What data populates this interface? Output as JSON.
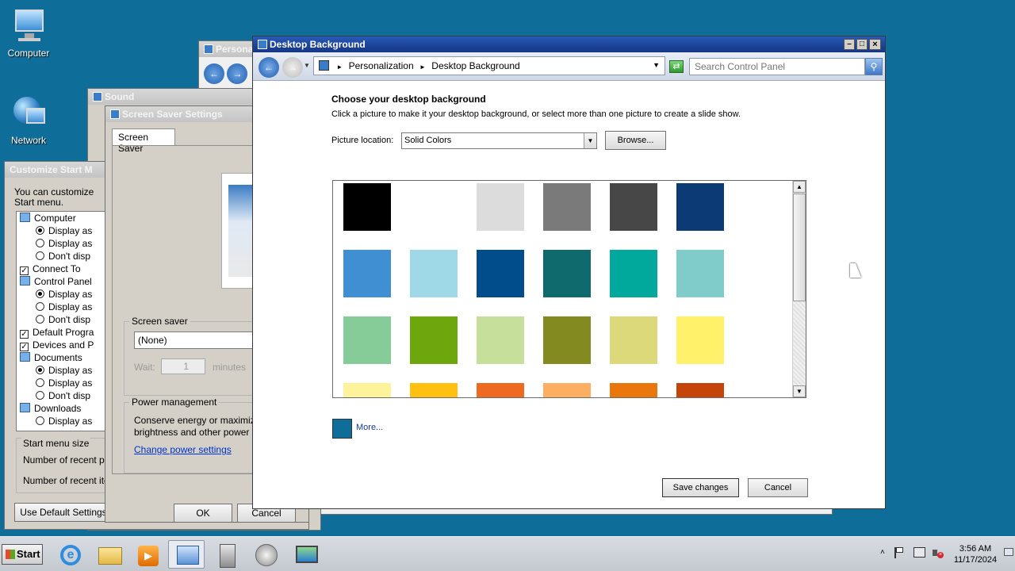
{
  "desktop": {
    "icons": [
      {
        "label": "Computer"
      },
      {
        "label": "Network"
      }
    ]
  },
  "customize_start": {
    "title": "Customize Start M",
    "intro": "You can customize\nStart menu.",
    "items": [
      {
        "kind": "header",
        "label": "Computer"
      },
      {
        "kind": "radio",
        "label": "Display as",
        "checked": true
      },
      {
        "kind": "radio",
        "label": "Display as",
        "checked": false
      },
      {
        "kind": "radio",
        "label": "Don't disp",
        "checked": false
      },
      {
        "kind": "check",
        "label": "Connect To",
        "checked": true
      },
      {
        "kind": "header",
        "label": "Control Panel"
      },
      {
        "kind": "radio",
        "label": "Display as",
        "checked": true
      },
      {
        "kind": "radio",
        "label": "Display as",
        "checked": false
      },
      {
        "kind": "radio",
        "label": "Don't disp",
        "checked": false
      },
      {
        "kind": "check",
        "label": "Default Progra",
        "checked": true
      },
      {
        "kind": "check",
        "label": "Devices and P",
        "checked": true
      },
      {
        "kind": "header",
        "label": "Documents"
      },
      {
        "kind": "radio",
        "label": "Display as",
        "checked": true
      },
      {
        "kind": "radio",
        "label": "Display as",
        "checked": false
      },
      {
        "kind": "radio",
        "label": "Don't disp",
        "checked": false
      },
      {
        "kind": "header",
        "label": "Downloads"
      },
      {
        "kind": "radio",
        "label": "Display as",
        "checked": false
      }
    ],
    "size_group": "Start menu size",
    "recent_programs": "Number of recent pro",
    "recent_items": "Number of recent item",
    "default_btn": "Use Default Settings"
  },
  "sound": {
    "title": "Sound"
  },
  "screensaver": {
    "title": "Screen Saver Settings",
    "tab": "Screen Saver",
    "group_label": "Screen saver",
    "selected": "(None)",
    "wait_label": "Wait:",
    "wait_value": "1",
    "minutes": "minutes",
    "power_group": "Power management",
    "power_text": "Conserve energy or maximiz",
    "power_text2": "brightness and other power s",
    "power_link": "Change power settings",
    "ok": "OK",
    "cancel": "Cancel"
  },
  "personalization": {
    "title": "Personal"
  },
  "desktop_bg": {
    "title": "Desktop Background",
    "breadcrumb": [
      "Personalization",
      "Desktop Background"
    ],
    "search_placeholder": "Search Control Panel",
    "heading": "Choose your desktop background",
    "instructions": "Click a picture to make it your desktop background, or select more than one picture to create a slide show.",
    "location_label": "Picture location:",
    "location_value": "Solid Colors",
    "browse": "Browse...",
    "swatches": [
      "#000000",
      "#ffffff",
      "#dcdcdc",
      "#7a7a7a",
      "#474747",
      "#0c3a75",
      "#3f8fd2",
      "#9fd8e7",
      "#014c8a",
      "#0f6a6d",
      "#01a99c",
      "#7fccca",
      "#85cc99",
      "#6ea70d",
      "#c6e09c",
      "#838a1f",
      "#dcd97a",
      "#fff26a",
      "#fef39a",
      "#ffc010",
      "#ee6a20",
      "#fbb061",
      "#e9770b",
      "#c44409"
    ],
    "more_color": "#0f6e99",
    "more_label": "More...",
    "save": "Save changes",
    "cancel": "Cancel"
  },
  "taskbar": {
    "start": "Start",
    "time": "3:56 AM",
    "date": "11/17/2024"
  }
}
